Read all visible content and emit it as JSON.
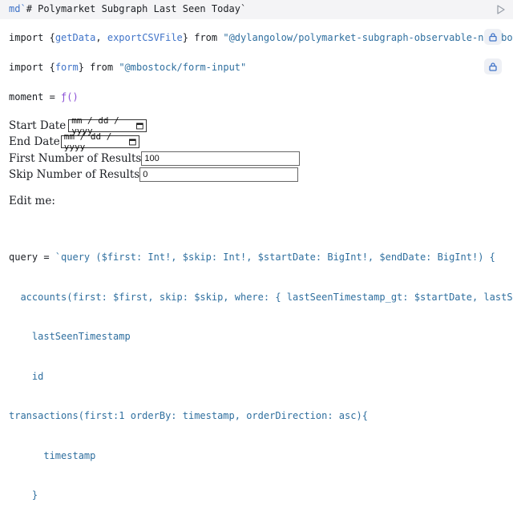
{
  "header": {
    "prefix": "md`",
    "markdown": "# Polymarket Subgraph Last Seen Today",
    "suffix": "`"
  },
  "imports": [
    {
      "keyword": "import",
      "open": " {",
      "names": [
        "getData",
        "exportCSVFile"
      ],
      "close": "}",
      "from": " from ",
      "source": "\"@dylangolow/polymarket-subgraph-observable-notebook\""
    },
    {
      "keyword": "import",
      "open": " {",
      "names": [
        "form"
      ],
      "close": "}",
      "from": " from ",
      "source": "\"@mbostock/form-input\""
    }
  ],
  "moment_line": {
    "name": "moment",
    "eq": " = ",
    "value": "ƒ()"
  },
  "form": {
    "start_label": "Start Date",
    "start_placeholder": "mm / dd / yyyy",
    "end_label": "End Date",
    "end_placeholder": "mm / dd / yyyy",
    "first_label": "First Number of Results",
    "first_value": "100",
    "skip_label": "Skip Number of Results",
    "skip_value": "0"
  },
  "edit_label": "Edit me:",
  "query_lines": [
    "query = `query ($first: Int!, $skip: Int!, $startDate: BigInt!, $endDate: BigInt!) {",
    "  accounts(first: $first, skip: $skip, where: { lastSeenTimestamp_gt: $startDate, lastSeenTimestamp_lt: $endDate }) {",
    "    lastSeenTimestamp",
    "    id",
    "transactions(first:1 orderBy: timestamp, orderDirection: asc){",
    "      timestamp",
    "    }"
  ]
}
